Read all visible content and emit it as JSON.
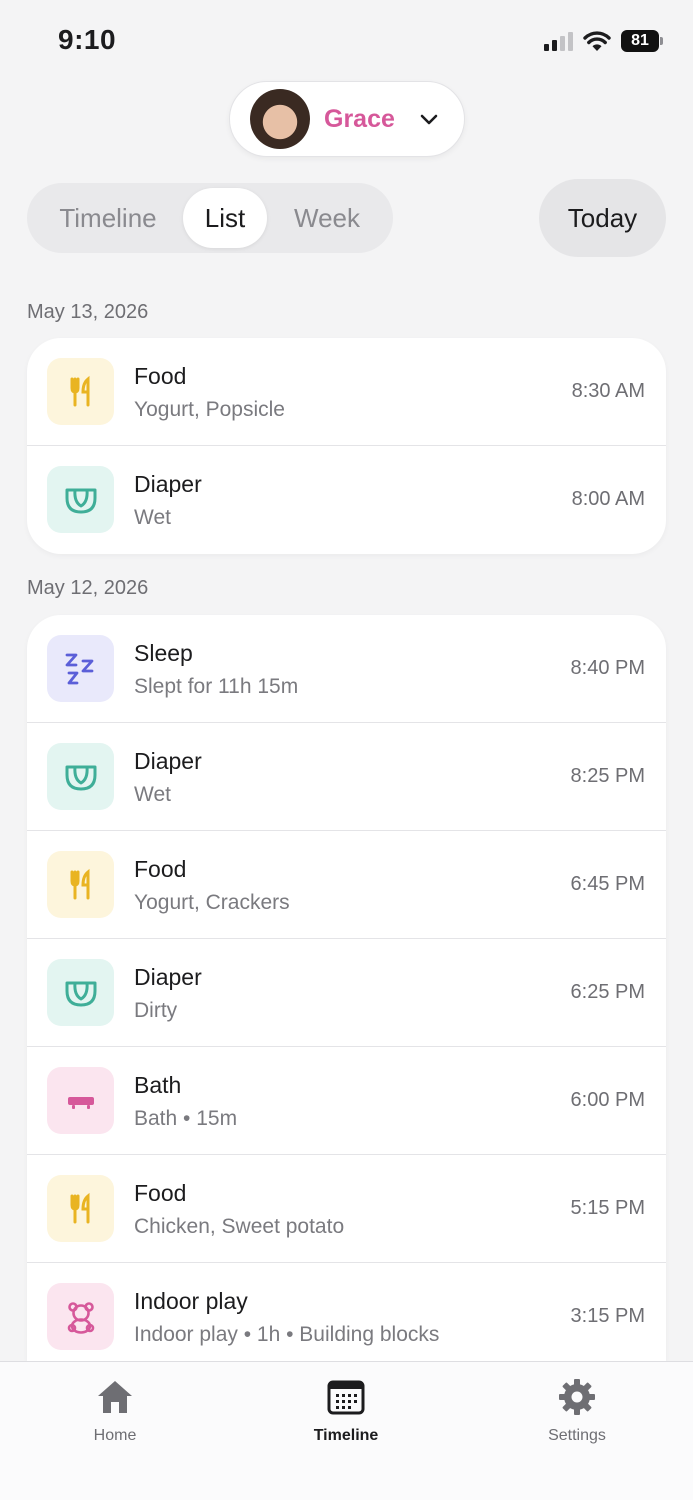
{
  "status_bar": {
    "time": "9:10",
    "battery": "81"
  },
  "child": {
    "name": "Grace"
  },
  "view_tabs": {
    "timeline": "Timeline",
    "list": "List",
    "week": "Week",
    "selected": "List"
  },
  "today_button": "Today",
  "sections": [
    {
      "date": "May 13, 2026",
      "entries": [
        {
          "type": "food",
          "icon": "fork-knife-icon",
          "title": "Food",
          "detail": "Yogurt, Popsicle",
          "time": "8:30 AM"
        },
        {
          "type": "diaper",
          "icon": "diaper-icon",
          "title": "Diaper",
          "detail": "Wet",
          "time": "8:00 AM"
        }
      ]
    },
    {
      "date": "May 12, 2026",
      "entries": [
        {
          "type": "sleep",
          "icon": "zzz-icon",
          "title": "Sleep",
          "detail": "Slept for 11h 15m",
          "time": "8:40 PM"
        },
        {
          "type": "diaper",
          "icon": "diaper-icon",
          "title": "Diaper",
          "detail": "Wet",
          "time": "8:25 PM"
        },
        {
          "type": "food",
          "icon": "fork-knife-icon",
          "title": "Food",
          "detail": "Yogurt, Crackers",
          "time": "6:45 PM"
        },
        {
          "type": "diaper",
          "icon": "diaper-icon",
          "title": "Diaper",
          "detail": "Dirty",
          "time": "6:25 PM"
        },
        {
          "type": "bath",
          "icon": "bathtub-icon",
          "title": "Bath",
          "detail": "Bath • 15m",
          "time": "6:00 PM"
        },
        {
          "type": "food",
          "icon": "fork-knife-icon",
          "title": "Food",
          "detail": "Chicken, Sweet potato",
          "time": "5:15 PM"
        },
        {
          "type": "play",
          "icon": "teddy-bear-icon",
          "title": "Indoor play",
          "detail": "Indoor play • 1h • Building blocks",
          "time": "3:15 PM"
        }
      ]
    }
  ],
  "tab_bar": {
    "home": "Home",
    "timeline": "Timeline",
    "settings": "Settings",
    "active": "Timeline"
  },
  "colors": {
    "accent_pink": "#d6589a",
    "food": "#e9b422",
    "diaper": "#3fae98",
    "sleep": "#5b5fd8",
    "bath_play": "#d6589a"
  }
}
